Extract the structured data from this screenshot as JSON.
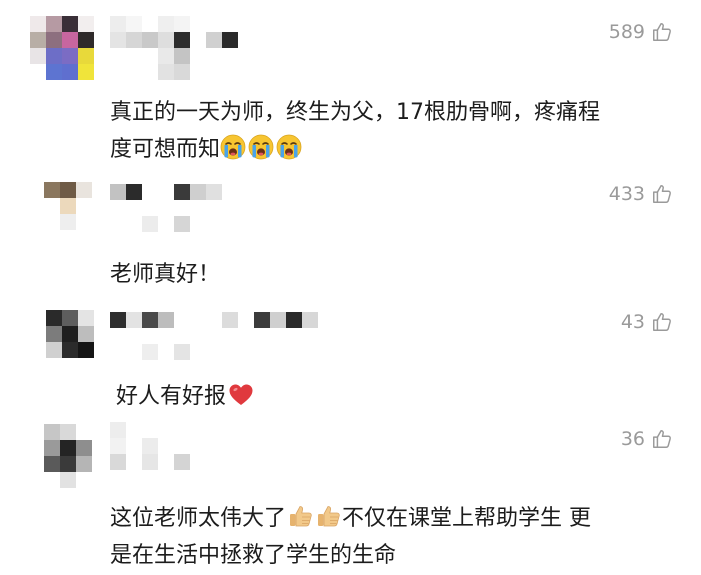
{
  "comments": [
    {
      "likes": "589",
      "lines": [
        "真正的一天为师，终生为父，17根肋骨啊，疼痛程",
        "度可想而知"
      ],
      "emojis": [
        "crying-face",
        "crying-face",
        "crying-face"
      ]
    },
    {
      "likes": "433",
      "lines": [
        "老师真好！"
      ]
    },
    {
      "likes": "43",
      "lines": [
        "好人有好报"
      ],
      "emojis": [
        "red-heart"
      ]
    },
    {
      "likes": "36",
      "lines": [
        "这位老师太伟大了",
        "不仅在课堂上帮助学生 更",
        "是在生活中拯救了学生的生命"
      ],
      "emojis": [
        "thumbs-up",
        "thumbs-up"
      ]
    }
  ],
  "colors": {
    "like_gray": "#9a9a9a",
    "text": "#1c1c1c",
    "heart": "#e0393e",
    "thumb": "#f2c98a",
    "crying_face": "#f7c531",
    "tear": "#4aa3e8"
  },
  "icons": [
    "thumbs-up-outline-icon",
    "crying-face-emoji",
    "red-heart-emoji",
    "thumbs-up-emoji"
  ]
}
